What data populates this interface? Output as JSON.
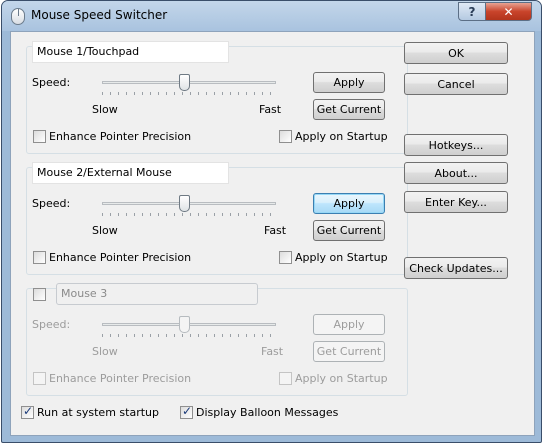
{
  "window": {
    "title": "Mouse Speed Switcher",
    "help_glyph": "?",
    "close_glyph": "✕"
  },
  "mouse1": {
    "name": "Mouse 1/Touchpad",
    "speed_label": "Speed:",
    "slow_label": "Slow",
    "fast_label": "Fast",
    "apply_label": "Apply",
    "get_current_label": "Get Current",
    "enhance_label": "Enhance Pointer Precision",
    "startup_label": "Apply on Startup",
    "enhance_checked": false,
    "startup_checked": false
  },
  "mouse2": {
    "name": "Mouse 2/External Mouse",
    "speed_label": "Speed:",
    "slow_label": "Slow",
    "fast_label": "Fast",
    "apply_label": "Apply",
    "get_current_label": "Get Current",
    "enhance_label": "Enhance Pointer Precision",
    "startup_label": "Apply on Startup",
    "enhance_checked": false,
    "startup_checked": false
  },
  "mouse3": {
    "name": "Mouse 3",
    "enabled": false,
    "speed_label": "Speed:",
    "slow_label": "Slow",
    "fast_label": "Fast",
    "apply_label": "Apply",
    "get_current_label": "Get Current",
    "enhance_label": "Enhance Pointer Precision",
    "startup_label": "Apply on Startup",
    "enhance_checked": false,
    "startup_checked": false
  },
  "side_buttons": {
    "ok": "OK",
    "cancel": "Cancel",
    "hotkeys": "Hotkeys...",
    "about": "About...",
    "enter_key": "Enter Key...",
    "check_updates": "Check Updates..."
  },
  "footer": {
    "run_at_startup_label": "Run at system startup",
    "run_at_startup_checked": true,
    "balloon_label": "Display Balloon Messages",
    "balloon_checked": true
  },
  "icons": {
    "app": "mouse-icon",
    "help": "help-icon",
    "close": "close-icon",
    "slider_thumb": "slider-thumb-icon"
  }
}
